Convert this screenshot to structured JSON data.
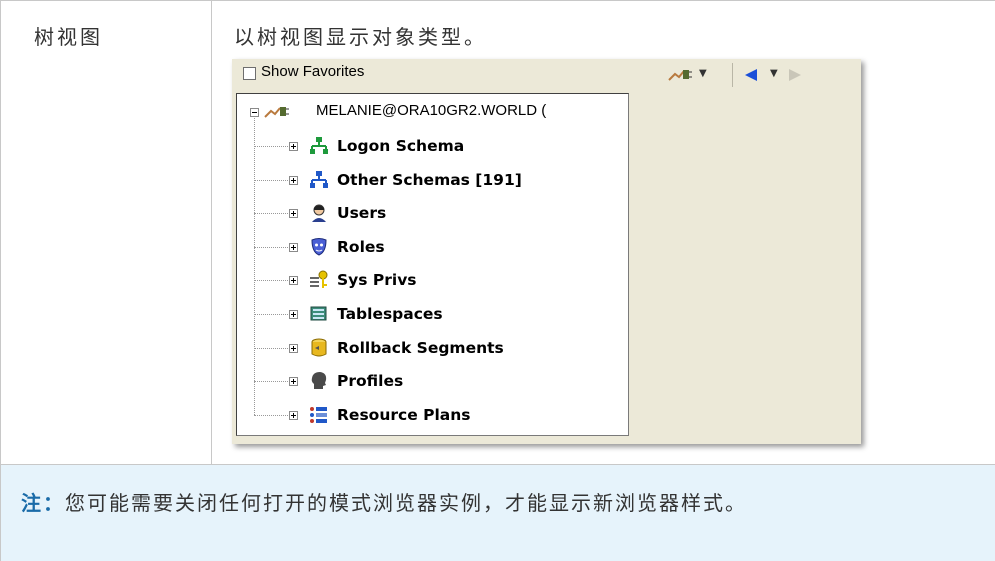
{
  "row1": {
    "term": "树视图",
    "definition": "以树视图显示对象类型。"
  },
  "screenshot": {
    "show_favorites_label": "Show Favorites",
    "show_favorites_checked": false,
    "root_node": "MELANIE@ORA10GR2.WORLD (",
    "nodes": [
      {
        "label": "Logon Schema",
        "icon": "schema-icon-green"
      },
      {
        "label": "Other Schemas [191]",
        "icon": "schema-icon-blue"
      },
      {
        "label": "Users",
        "icon": "user-icon"
      },
      {
        "label": "Roles",
        "icon": "roles-mask-icon"
      },
      {
        "label": "Sys Privs",
        "icon": "sys-privs-key-icon"
      },
      {
        "label": "Tablespaces",
        "icon": "tablespaces-icon"
      },
      {
        "label": "Rollback Segments",
        "icon": "rollback-segments-icon"
      },
      {
        "label": "Profiles",
        "icon": "profile-head-icon"
      },
      {
        "label": "Resource Plans",
        "icon": "resource-plans-icon"
      }
    ],
    "toolbar": {
      "connection_icon": "connection-plug-icon",
      "back_icon": "back-arrow-icon",
      "forward_icon": "forward-arrow-icon"
    }
  },
  "note": {
    "prefix": "注：",
    "text": "您可能需要关闭任何打开的模式浏览器实例，才能显示新浏览器样式。"
  },
  "colors": {
    "note_background": "#e6f3fb",
    "note_prefix": "#1a6ba8"
  }
}
